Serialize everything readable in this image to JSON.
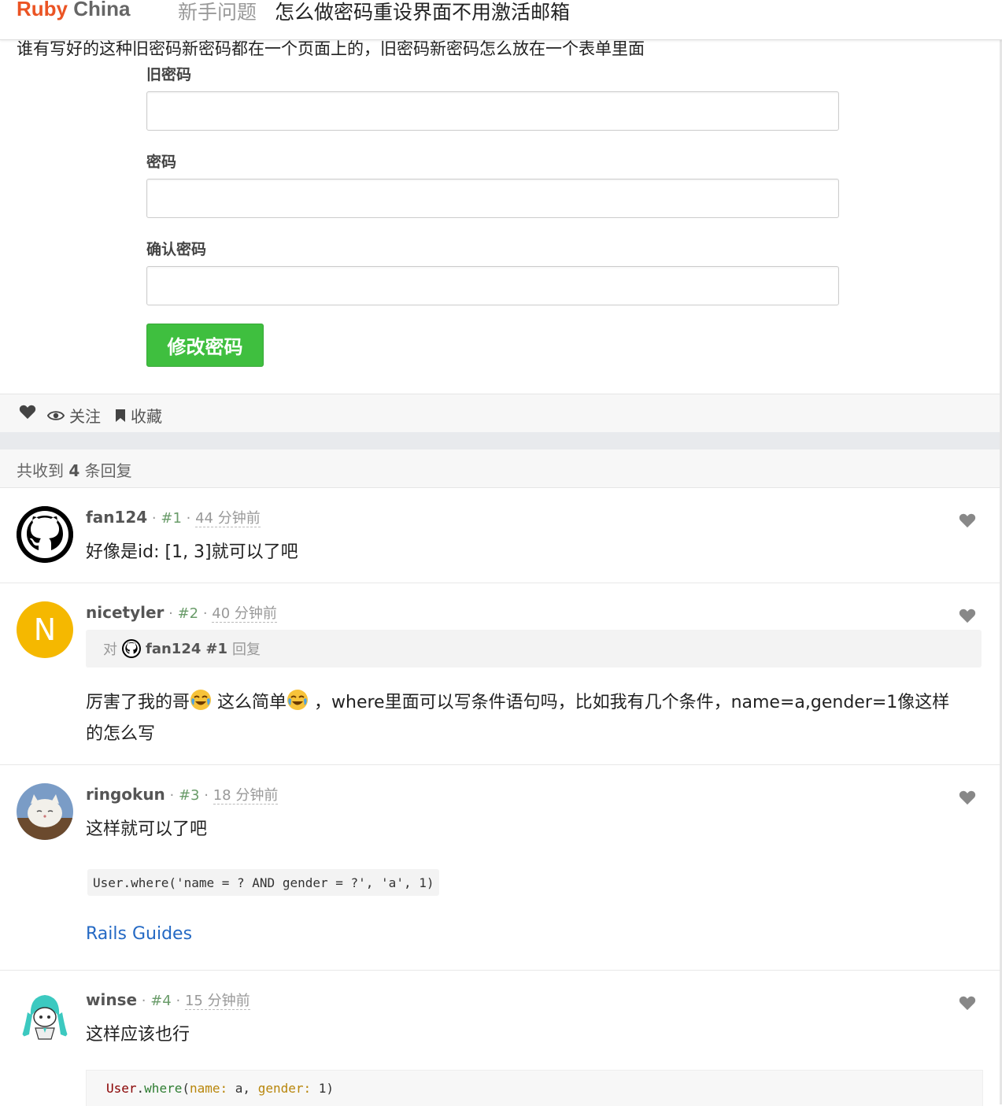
{
  "header": {
    "brand_ruby": "Ruby",
    "brand_china": "China",
    "node": "新手问题",
    "title": "怎么做密码重设界面不用激活邮箱"
  },
  "topic": {
    "intro": "谁有写好的这种旧密码新密码都在一个页面上的，旧密码新密码怎么放在一个表单里面",
    "fields": [
      {
        "label": "旧密码"
      },
      {
        "label": "密码"
      },
      {
        "label": "确认密码"
      }
    ],
    "submit_label": "修改密码"
  },
  "actions": {
    "follow": "关注",
    "favorite": "收藏"
  },
  "replies_header": {
    "prefix": "共收到",
    "count": "4",
    "suffix": "条回复"
  },
  "replies": [
    {
      "user": "fan124",
      "floor": "#1",
      "time": "44 分钟前",
      "text": "好像是id: [1, 3]就可以了吧"
    },
    {
      "user": "nicetyler",
      "floor": "#2",
      "time": "40 分钟前",
      "avatar_letter": "N",
      "quote_prefix": "对",
      "quote_user": "fan124",
      "quote_floor": "#1",
      "quote_suffix": "回复",
      "text_a": "厉害了我的哥",
      "text_b": " 这么简单",
      "text_c": " ，where里面可以写条件语句吗，比如我有几个条件，name=a,gender=1像这样",
      "text_d": "的怎么写"
    },
    {
      "user": "ringokun",
      "floor": "#3",
      "time": "18 分钟前",
      "text": "这样就可以了吧",
      "code": "User.where('name = ? AND gender = ?', 'a', 1)",
      "link": "Rails Guides"
    },
    {
      "user": "winse",
      "floor": "#4",
      "time": "15 分钟前",
      "text": "这样应该也行",
      "code": {
        "const": "User",
        "dot": ".",
        "meth": "where",
        "open": "(",
        "k1": "name:",
        "v1": " a, ",
        "k2": "gender:",
        "v2": " 1",
        "close": ")"
      }
    }
  ],
  "colors": {
    "brand": "#eb5424",
    "submit": "#3fbf3f",
    "link": "#2469c4"
  }
}
